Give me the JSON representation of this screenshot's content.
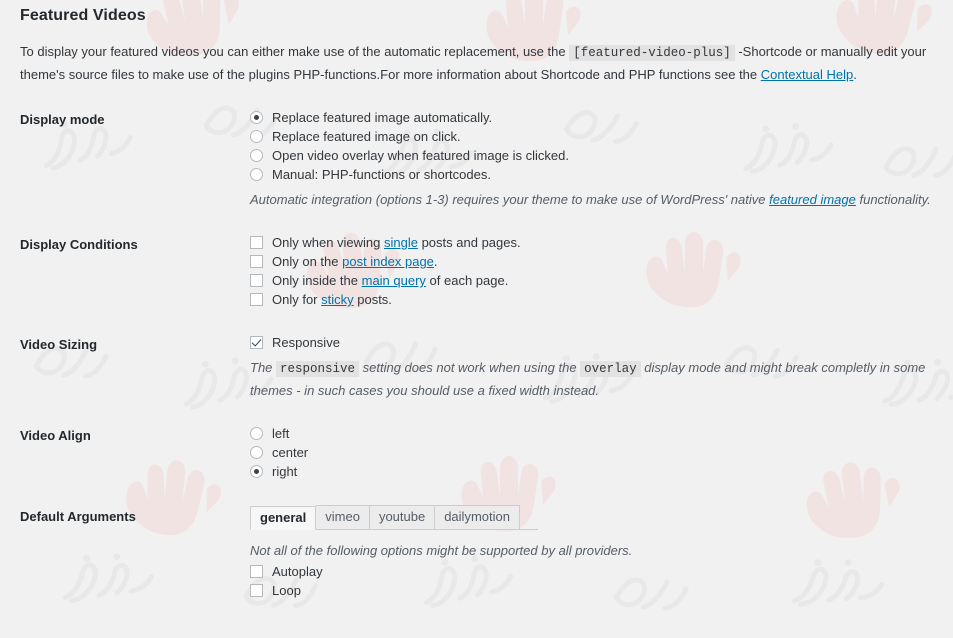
{
  "page": {
    "title": "Featured Videos",
    "intro": {
      "part1": "To display your featured videos you can either make use of the automatic replacement, use the ",
      "shortcode": "[featured-video-plus]",
      "part2": " -Shortcode or manually edit your theme's source files to make use of the plugins PHP-functions.For more information about Shortcode and PHP functions see the ",
      "help_link": "Contextual Help",
      "part3": "."
    }
  },
  "sections": {
    "display_mode": {
      "label": "Display mode",
      "options": [
        {
          "label": "Replace featured image automatically.",
          "checked": true
        },
        {
          "label": "Replace featured image on click.",
          "checked": false
        },
        {
          "label": "Open video overlay when featured image is clicked.",
          "checked": false
        },
        {
          "label": "Manual: PHP-functions or shortcodes.",
          "checked": false
        }
      ],
      "desc_part1": "Automatic integration (options 1-3) requires your theme to make use of WordPress' native ",
      "desc_link": "featured image",
      "desc_part2": " functionality."
    },
    "display_conditions": {
      "label": "Display Conditions",
      "options": [
        {
          "pre": "Only when viewing ",
          "link": "single",
          "post": " posts and pages.",
          "checked": false
        },
        {
          "pre": "Only on the ",
          "link": "post index page",
          "post": ".",
          "checked": false
        },
        {
          "pre": "Only inside the ",
          "link": "main query",
          "post": " of each page.",
          "checked": false
        },
        {
          "pre": "Only for ",
          "link": "sticky",
          "post": " posts.",
          "checked": false
        }
      ]
    },
    "video_sizing": {
      "label": "Video Sizing",
      "responsive_label": "Responsive",
      "responsive_checked": true,
      "desc_part1": "The ",
      "desc_code1": "responsive",
      "desc_part2": " setting does not work when using the ",
      "desc_code2": "overlay",
      "desc_part3": " display mode and might break completly in some themes - in such cases you should use a fixed width instead."
    },
    "video_align": {
      "label": "Video Align",
      "options": [
        {
          "label": "left",
          "checked": false
        },
        {
          "label": "center",
          "checked": false
        },
        {
          "label": "right",
          "checked": true
        }
      ]
    },
    "default_arguments": {
      "label": "Default Arguments",
      "tabs": [
        {
          "label": "general",
          "active": true
        },
        {
          "label": "vimeo",
          "active": false
        },
        {
          "label": "youtube",
          "active": false
        },
        {
          "label": "dailymotion",
          "active": false
        }
      ],
      "note": "Not all of the following options might be supported by all providers.",
      "options": [
        {
          "label": "Autoplay",
          "checked": false
        },
        {
          "label": "Loop",
          "checked": false
        }
      ]
    }
  },
  "colors": {
    "background": "#f1f1f1",
    "link": "#0073aa",
    "text": "#32373c",
    "label": "#23282d",
    "code_bg": "#e2e2e2",
    "watermark_hand": "#f6dada",
    "watermark_script": "#e6e6e6"
  }
}
